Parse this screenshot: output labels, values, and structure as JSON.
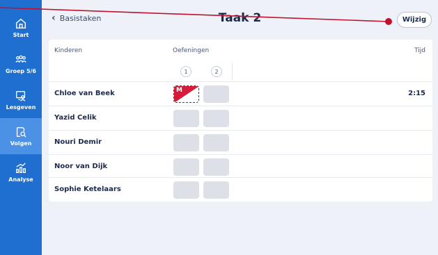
{
  "sidebar": {
    "items": [
      {
        "label": "Start",
        "icon": "home-icon",
        "active": false
      },
      {
        "label": "Groep 5/6",
        "icon": "group-icon",
        "active": false
      },
      {
        "label": "Lesgeven",
        "icon": "teach-icon",
        "active": false
      },
      {
        "label": "Volgen",
        "icon": "track-icon",
        "active": true
      },
      {
        "label": "Analyse",
        "icon": "chart-icon",
        "active": false
      }
    ]
  },
  "header": {
    "back_label": "Basistaken",
    "title": "Taak 2",
    "edit_label": "Wijzig"
  },
  "table": {
    "col_children": "Kinderen",
    "col_exercises": "Oefeningen",
    "col_time": "Tijd",
    "exercise_numbers": [
      "1",
      "2"
    ],
    "rows": [
      {
        "name": "Chloe van Beek",
        "marked": "M",
        "time": "2:15"
      },
      {
        "name": "Yazid Celik",
        "time": ""
      },
      {
        "name": "Nouri Demir",
        "time": ""
      },
      {
        "name": "Noor van Dijk",
        "time": ""
      },
      {
        "name": "Sophie Ketelaars",
        "time": ""
      }
    ]
  },
  "colors": {
    "sidebar": "#1f6fd1",
    "sidebar_active": "#4b92e6",
    "mark_red": "#d51c3a",
    "annotation": "#c0122e"
  }
}
